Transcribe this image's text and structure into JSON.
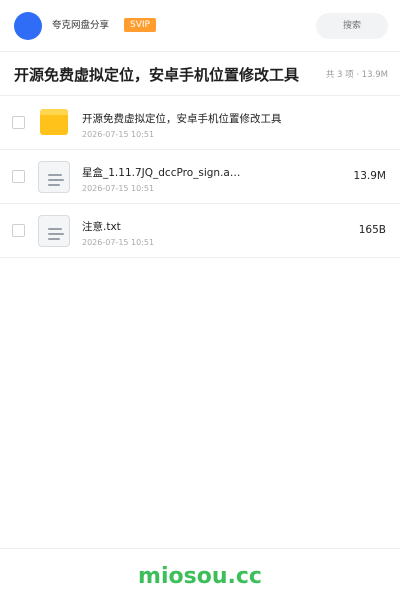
{
  "header": {
    "title": "夸克网盘分享",
    "badge": "SVIP",
    "search_placeholder": "搜索"
  },
  "share": {
    "title": "开源免费虚拟定位，安卓手机位置修改工具",
    "summary": "共 3 项 · 13.9M"
  },
  "files": [
    {
      "type": "folder",
      "icon": "folder-icon",
      "name": "开源免费虚拟定位，安卓手机位置修改工具",
      "date": "2026-07-15 10:51",
      "size": ""
    },
    {
      "type": "file",
      "icon": "document-icon",
      "name": "星盒_1.11.7JQ_dccPro_sign.a…",
      "date": "2026-07-15 10:51",
      "size": "13.9M"
    },
    {
      "type": "file",
      "icon": "document-icon",
      "name": "注意.txt",
      "date": "2026-07-15 10:51",
      "size": "165B"
    }
  ],
  "footer": {
    "brand": "miosou.cc"
  },
  "colors": {
    "avatar": "#2f6df6",
    "badge": "#ff9d2e",
    "folder": "#ffc21a",
    "brand": "#3cbf5a"
  }
}
